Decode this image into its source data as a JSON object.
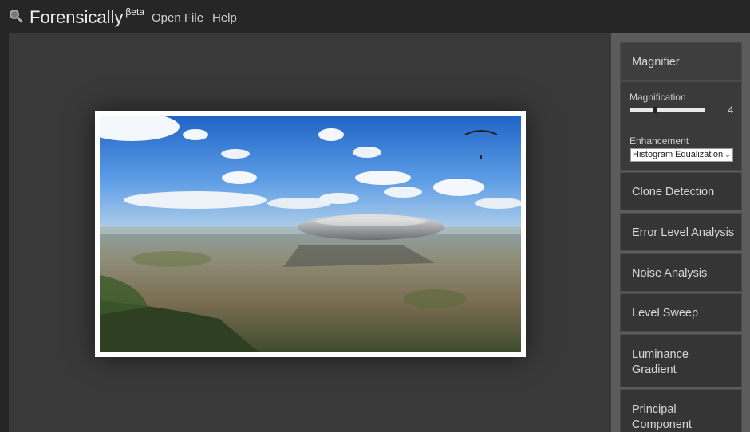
{
  "app": {
    "brand": "Forensically",
    "brand_sup": "βeta",
    "logo_icon": "magnifying-glass-icon"
  },
  "nav": {
    "open_file": "Open File",
    "help": "Help"
  },
  "sidebar": {
    "magnifier": {
      "label": "Magnifier",
      "magnification_label": "Magnification",
      "magnification_value": "4",
      "magnification_fraction": 0.32,
      "enhancement_label": "Enhancement",
      "enhancement_value": "Histogram Equalization"
    },
    "tools": [
      "Clone Detection",
      "Error Level Analysis",
      "Noise Analysis",
      "Level Sweep",
      "Luminance Gradient",
      "Principal Component"
    ]
  },
  "colors": {
    "topbar": "#262626",
    "canvas": "#393939",
    "sidebar": "#5c5c5c",
    "tool_bg": "#353535"
  }
}
